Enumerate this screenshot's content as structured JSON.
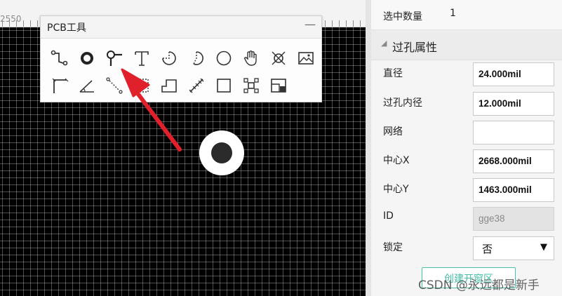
{
  "canvas": {
    "ruler_label": "2550",
    "grid_color": "#ffffff",
    "background": "#000000"
  },
  "toolbar": {
    "title": "PCB工具",
    "minimize_glyph": "—",
    "row1": [
      "track-icon",
      "via-icon",
      "pad-icon",
      "text-icon",
      "arc-cw-icon",
      "arc-ccw-icon",
      "circle-icon",
      "hand-icon",
      "hole-icon",
      "image-icon"
    ],
    "row2": [
      "dimension-icon",
      "angle-icon",
      "connect-icon",
      "copper-area-icon",
      "solid-region-icon",
      "measure-icon",
      "rectangle-icon",
      "group-icon",
      "board-outline-icon"
    ]
  },
  "panel": {
    "selected_label": "选中数量",
    "selected_value": "1",
    "section_title": "过孔属性",
    "properties": [
      {
        "label": "直径",
        "value": "24.000mil"
      },
      {
        "label": "过孔内径",
        "value": "12.000mil"
      },
      {
        "label": "网络",
        "value": ""
      },
      {
        "label": "中心X",
        "value": "2668.000mil"
      },
      {
        "label": "中心Y",
        "value": "1463.000mil"
      },
      {
        "label": "ID",
        "value": "gge38"
      }
    ],
    "lock_label": "锁定",
    "lock_value": "否",
    "partial_button": "创建开窗区"
  },
  "watermark": "CSDN @永远都是新手",
  "colors": {
    "accent": "#46c0a8",
    "arrow": "#e0202a"
  }
}
